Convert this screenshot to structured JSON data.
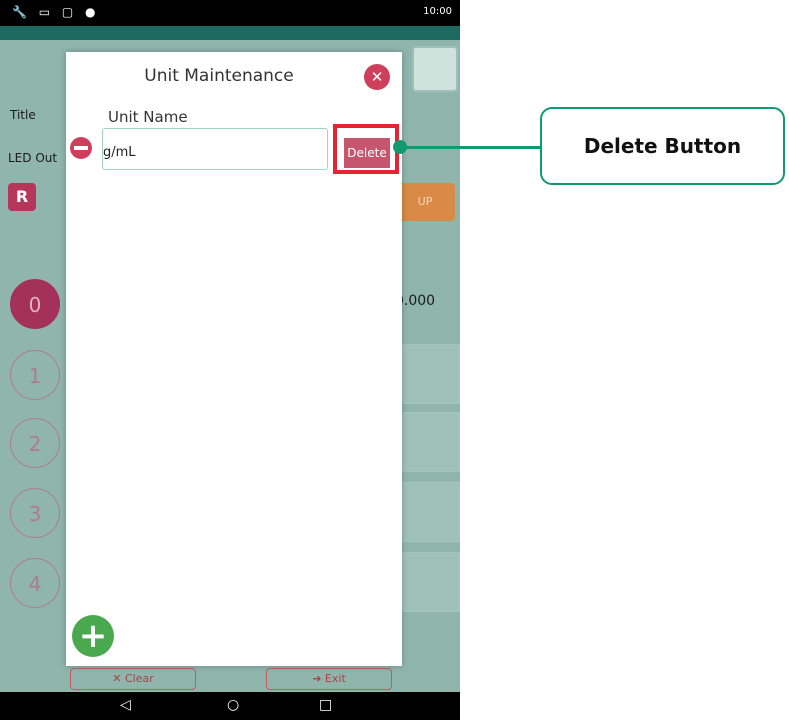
{
  "status_bar": {
    "time": "10:00"
  },
  "background": {
    "title_label": "Title",
    "led_label": "LED Out",
    "r_button": "R",
    "orange_button": "UP",
    "channels": [
      "0",
      "1",
      "2",
      "3",
      "4"
    ],
    "first_value": "0.000",
    "clear_button": "✕ Clear",
    "exit_button": "➜ Exit"
  },
  "dialog": {
    "title": "Unit Maintenance",
    "column_header": "Unit Name",
    "rows": [
      {
        "unit": "g/mL",
        "delete_label": "Delete"
      }
    ]
  },
  "callout": {
    "label": "Delete Button"
  },
  "colors": {
    "accent": "#0f9a70",
    "delete": "#c6566d",
    "highlight": "#e52431",
    "add": "#4aa84f"
  }
}
